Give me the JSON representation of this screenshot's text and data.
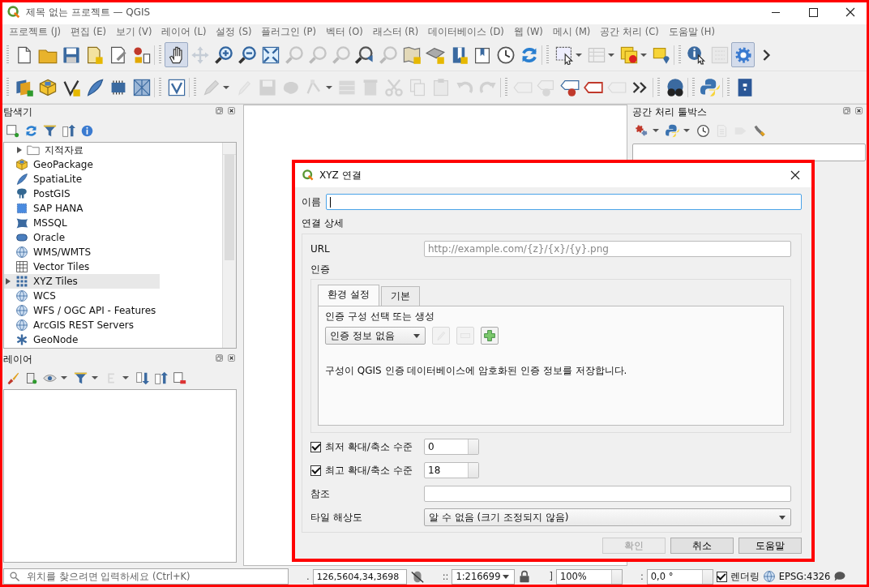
{
  "window": {
    "title": "제목 없는 프로젝트 — QGIS"
  },
  "menu": [
    "프로젝트 (J)",
    "편집 (E)",
    "보기 (V)",
    "레이어 (L)",
    "설정 (S)",
    "플러그인 (P)",
    "벡터 (O)",
    "래스터 (R)",
    "데이터베이스 (D)",
    "웹 (W)",
    "메시 (M)",
    "공간 처리 (C)",
    "도움말 (H)"
  ],
  "toolbars": [
    [
      {
        "kind": "button",
        "disabled": false,
        "selected": false
      },
      {
        "kind": "button",
        "disabled": false,
        "selected": false
      },
      {
        "kind": "button",
        "disabled": false,
        "selected": false
      },
      {
        "kind": "button",
        "disabled": false,
        "selected": false
      },
      {
        "kind": "button",
        "disabled": false,
        "selected": false
      },
      {
        "kind": "button",
        "disabled": false,
        "selected": false
      },
      {
        "kind": "separator"
      },
      {
        "kind": "button",
        "disabled": false,
        "selected": true
      },
      {
        "kind": "button",
        "disabled": true,
        "selected": false
      },
      {
        "kind": "button",
        "disabled": false,
        "selected": false
      },
      {
        "kind": "button",
        "disabled": false,
        "selected": false
      },
      {
        "kind": "button",
        "disabled": false,
        "selected": false
      },
      {
        "kind": "button",
        "disabled": true,
        "selected": false
      },
      {
        "kind": "button",
        "disabled": true,
        "selected": false
      },
      {
        "kind": "button",
        "disabled": true,
        "selected": false
      },
      {
        "kind": "button",
        "disabled": false,
        "selected": false
      },
      {
        "kind": "button",
        "disabled": true,
        "selected": false
      },
      {
        "kind": "button",
        "disabled": false,
        "selected": false
      },
      {
        "kind": "button",
        "disabled": false,
        "selected": false
      },
      {
        "kind": "button",
        "disabled": false,
        "selected": false
      },
      {
        "kind": "button",
        "disabled": false,
        "selected": false
      },
      {
        "kind": "button",
        "disabled": false,
        "selected": false
      },
      {
        "kind": "button",
        "disabled": false,
        "selected": false
      },
      {
        "kind": "separator"
      },
      {
        "kind": "button",
        "disabled": false,
        "selected": false
      },
      {
        "kind": "button",
        "disabled": true,
        "selected": false
      },
      {
        "kind": "button",
        "disabled": false,
        "selected": false
      },
      {
        "kind": "button",
        "disabled": false,
        "selected": false
      },
      {
        "kind": "separator"
      },
      {
        "kind": "button",
        "disabled": false,
        "selected": false
      },
      {
        "kind": "button",
        "disabled": true,
        "selected": false
      },
      {
        "kind": "button",
        "disabled": false,
        "selected": true
      },
      {
        "kind": "button",
        "disabled": false,
        "selected": false
      }
    ],
    [
      {
        "kind": "button",
        "disabled": false,
        "selected": false
      },
      {
        "kind": "button",
        "disabled": false,
        "selected": false
      },
      {
        "kind": "button",
        "disabled": false,
        "selected": false
      },
      {
        "kind": "button",
        "disabled": false,
        "selected": false
      },
      {
        "kind": "button",
        "disabled": false,
        "selected": false
      },
      {
        "kind": "button",
        "disabled": false,
        "selected": false
      },
      {
        "kind": "separator"
      },
      {
        "kind": "button",
        "disabled": false,
        "selected": false
      },
      {
        "kind": "separator"
      },
      {
        "kind": "button",
        "disabled": true,
        "selected": false
      },
      {
        "kind": "button",
        "disabled": true,
        "selected": false
      },
      {
        "kind": "button",
        "disabled": true,
        "selected": false
      },
      {
        "kind": "button",
        "disabled": true,
        "selected": false
      },
      {
        "kind": "button",
        "disabled": true,
        "selected": false
      },
      {
        "kind": "button",
        "disabled": true,
        "selected": false
      },
      {
        "kind": "button",
        "disabled": true,
        "selected": false
      },
      {
        "kind": "button",
        "disabled": true,
        "selected": false
      },
      {
        "kind": "button",
        "disabled": true,
        "selected": false
      },
      {
        "kind": "button",
        "disabled": true,
        "selected": false
      },
      {
        "kind": "button",
        "disabled": true,
        "selected": false
      },
      {
        "kind": "button",
        "disabled": true,
        "selected": false
      },
      {
        "kind": "separator"
      },
      {
        "kind": "button",
        "disabled": true,
        "selected": false
      },
      {
        "kind": "button",
        "disabled": true,
        "selected": false
      },
      {
        "kind": "button",
        "disabled": false,
        "selected": false
      },
      {
        "kind": "button",
        "disabled": false,
        "selected": false
      },
      {
        "kind": "button",
        "disabled": true,
        "selected": false
      },
      {
        "kind": "button",
        "disabled": false,
        "selected": false
      },
      {
        "kind": "separator"
      },
      {
        "kind": "button",
        "disabled": false,
        "selected": false
      },
      {
        "kind": "separator"
      },
      {
        "kind": "button",
        "disabled": false,
        "selected": false
      },
      {
        "kind": "separator"
      },
      {
        "kind": "button",
        "disabled": false,
        "selected": false
      }
    ]
  ],
  "browser_panel": {
    "title": "탐색기",
    "toolbar": [
      {
        "disabled": false
      },
      {
        "disabled": false
      },
      {
        "disabled": false
      },
      {
        "disabled": false
      },
      {
        "disabled": false
      }
    ],
    "items": [
      {
        "label": "지적자료",
        "kind": "folder",
        "expandable": true,
        "selected": false
      },
      {
        "label": "GeoPackage",
        "kind": "provider",
        "expandable": false,
        "selected": false
      },
      {
        "label": "SpatiaLite",
        "kind": "provider",
        "expandable": false,
        "selected": false
      },
      {
        "label": "PostGIS",
        "kind": "provider",
        "expandable": false,
        "selected": false
      },
      {
        "label": "SAP HANA",
        "kind": "provider",
        "expandable": false,
        "selected": false
      },
      {
        "label": "MSSQL",
        "kind": "provider",
        "expandable": false,
        "selected": false
      },
      {
        "label": "Oracle",
        "kind": "provider",
        "expandable": false,
        "selected": false
      },
      {
        "label": "WMS/WMTS",
        "kind": "provider",
        "expandable": false,
        "selected": false
      },
      {
        "label": "Vector Tiles",
        "kind": "provider",
        "expandable": false,
        "selected": false
      },
      {
        "label": "XYZ Tiles",
        "kind": "provider",
        "expandable": true,
        "selected": true
      },
      {
        "label": "WCS",
        "kind": "provider",
        "expandable": false,
        "selected": false
      },
      {
        "label": "WFS / OGC API - Features",
        "kind": "provider",
        "expandable": false,
        "selected": false
      },
      {
        "label": "ArcGIS REST Servers",
        "kind": "provider",
        "expandable": false,
        "selected": false
      },
      {
        "label": "GeoNode",
        "kind": "provider",
        "expandable": false,
        "selected": false
      }
    ]
  },
  "layers_panel": {
    "title": "레이어",
    "toolbar": [
      {
        "disabled": false
      },
      {
        "disabled": false
      },
      {
        "disabled": false
      },
      {
        "disabled": false
      },
      {
        "disabled": true
      },
      {
        "disabled": false
      },
      {
        "disabled": false
      },
      {
        "disabled": false
      }
    ]
  },
  "processing_panel": {
    "title": "공간 처리 툴박스",
    "toolbar": [
      {
        "disabled": false
      },
      {
        "disabled": false
      },
      {
        "disabled": false
      },
      {
        "disabled": true
      },
      {
        "disabled": true
      },
      {
        "disabled": false
      }
    ]
  },
  "dialog": {
    "title": "XYZ 연결",
    "name": {
      "label": "이름",
      "focused": true
    },
    "group_title": "연결 상세",
    "url": {
      "label": "URL",
      "placeholder": "http://example.com/{z}/{x}/{y}.png"
    },
    "auth_label": "인증",
    "auth_tabs": [
      {
        "label": "환경 설정",
        "selected": true
      },
      {
        "label": "기본",
        "selected": false
      }
    ],
    "auth_prompt": "인증 구성 선택 또는 생성",
    "auth_combo": "인증 정보 없음",
    "auth_buttons": [
      {
        "disabled": true
      },
      {
        "disabled": true
      },
      {
        "disabled": false
      }
    ],
    "auth_note": "구성이 QGIS 인증 데이터베이스에 암호화된 인증 정보를 저장합니다.",
    "zoom_min": {
      "label": "최저 확대/축소 수준",
      "checked": true,
      "value": "0"
    },
    "zoom_max": {
      "label": "최고 확대/축소 수준",
      "checked": true,
      "value": "18"
    },
    "referer": {
      "label": "참조"
    },
    "tile_resolution": {
      "label": "타일 해상도",
      "value": "알 수 없음 (크기 조정되지 않음)"
    },
    "buttons": [
      {
        "label": "확인",
        "disabled": true
      },
      {
        "label": "취소",
        "disabled": false
      },
      {
        "label": "도움말",
        "disabled": false
      }
    ]
  },
  "status_bar": {
    "locator_placeholder": "위치를 찾으려면 입력하세요 (Ctrl+K)",
    "coordinate_label": ".",
    "coordinate": "126,5604,34,3698",
    "scale_label": "::",
    "scale": "1:216699",
    "magnifier_label": "]",
    "magnifier": "100%",
    "rotation_label": ":",
    "rotation": "0,0 °",
    "render": {
      "label": "렌더링",
      "checked": true
    },
    "crs": "EPSG:4326"
  }
}
